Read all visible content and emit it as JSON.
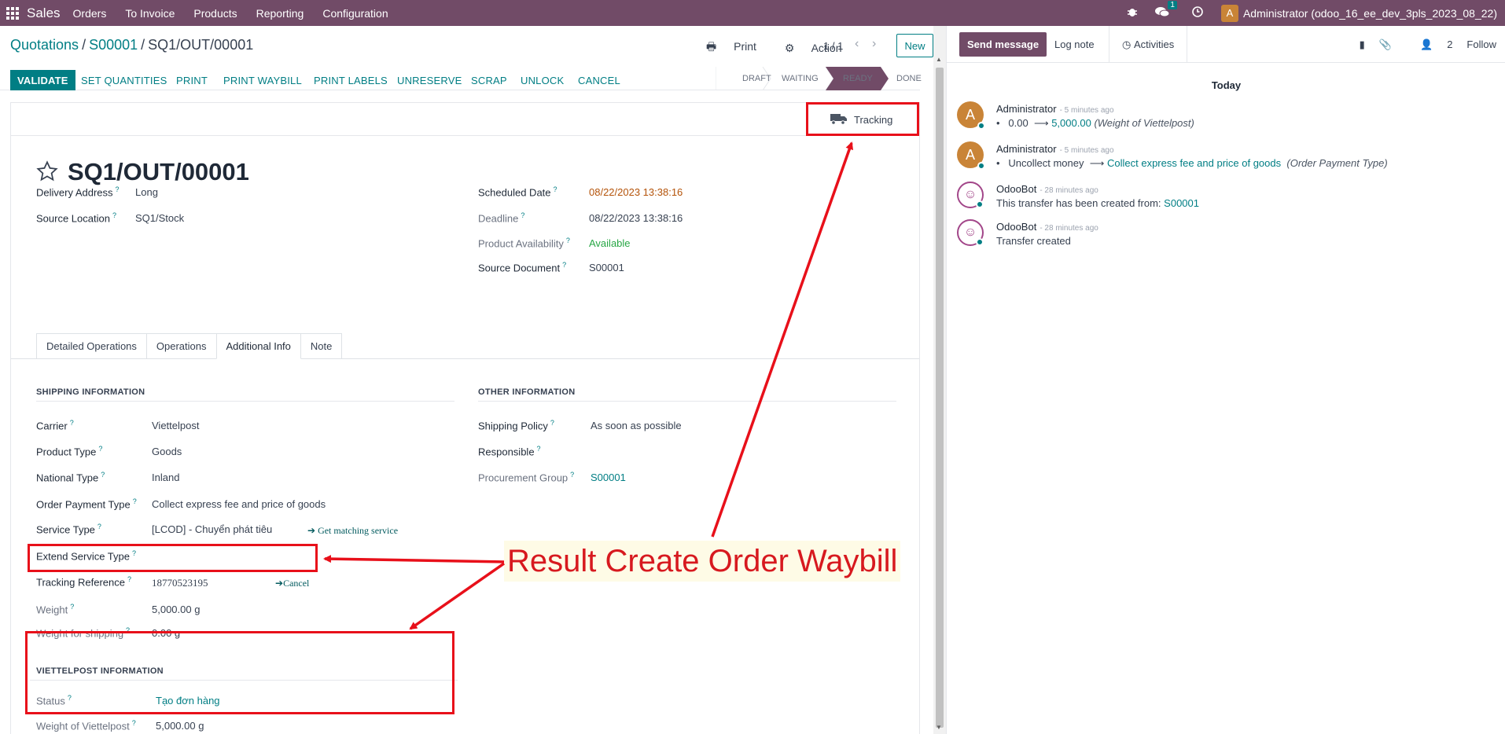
{
  "navbar": {
    "app_name": "Sales",
    "menu": [
      "Orders",
      "To Invoice",
      "Products",
      "Reporting",
      "Configuration"
    ],
    "chat_badge": "1",
    "user_initial": "A",
    "user_name": "Administrator (odoo_16_ee_dev_3pls_2023_08_22)"
  },
  "breadcrumb": {
    "root": "Quotations",
    "mid": "S00001",
    "current": "SQ1/OUT/00001"
  },
  "actions": {
    "print": "Print",
    "action": "Action"
  },
  "pager": "1 / 1",
  "new_button": "New",
  "statusbar": {
    "buttons": [
      "VALIDATE",
      "SET QUANTITIES",
      "PRINT",
      "PRINT WAYBILL",
      "PRINT LABELS",
      "UNRESERVE",
      "SCRAP",
      "UNLOCK",
      "CANCEL"
    ],
    "stages": [
      "DRAFT",
      "WAITING",
      "READY",
      "DONE"
    ],
    "active_stage": "READY"
  },
  "tracking_button": "Tracking",
  "record": {
    "title": "SQ1/OUT/00001",
    "delivery_address_label": "Delivery Address",
    "delivery_address": "Long",
    "source_location_label": "Source Location",
    "source_location": "SQ1/Stock",
    "scheduled_date_label": "Scheduled Date",
    "scheduled_date": "08/22/2023 13:38:16",
    "deadline_label": "Deadline",
    "deadline": "08/22/2023 13:38:16",
    "availability_label": "Product Availability",
    "availability": "Available",
    "source_document_label": "Source Document",
    "source_document": "S00001"
  },
  "tabs": [
    "Detailed Operations",
    "Operations",
    "Additional Info",
    "Note"
  ],
  "shipping": {
    "header": "SHIPPING INFORMATION",
    "carrier_label": "Carrier",
    "carrier": "Viettelpost",
    "product_type_label": "Product Type",
    "product_type": "Goods",
    "national_type_label": "National Type",
    "national_type": "Inland",
    "order_payment_type_label": "Order Payment Type",
    "order_payment_type": "Collect express fee and price of goods",
    "service_type_label": "Service Type",
    "service_type": "[LCOD] - Chuyển phát tiêu",
    "get_matching_service": "Get matching service",
    "extend_service_type_label": "Extend Service Type",
    "tracking_ref_label": "Tracking Reference",
    "tracking_ref": "18770523195",
    "cancel_link": "Cancel",
    "weight_label": "Weight",
    "weight": "5,000.00 g",
    "weight_shipping_label": "Weight for shipping",
    "weight_shipping": "0.00 g"
  },
  "other": {
    "header": "OTHER INFORMATION",
    "shipping_policy_label": "Shipping Policy",
    "shipping_policy": "As soon as possible",
    "responsible_label": "Responsible",
    "procurement_group_label": "Procurement Group",
    "procurement_group": "S00001"
  },
  "viettelpost": {
    "header": "VIETTELPOST INFORMATION",
    "status_label": "Status",
    "status": "Tạo đơn hàng",
    "weight_label": "Weight of Viettelpost",
    "weight": "5,000.00 g"
  },
  "annotation": "Result Create Order Waybill",
  "chatter": {
    "send_message": "Send message",
    "log_note": "Log note",
    "activities": "Activities",
    "followers_count": "2",
    "follow": "Follow",
    "today": "Today",
    "messages": [
      {
        "author": "Administrator",
        "time": "- 5 minutes ago",
        "old": "0.00",
        "new": "5,000.00",
        "field": "(Weight of Viettelpost)",
        "initial": "A"
      },
      {
        "author": "Administrator",
        "time": "- 5 minutes ago",
        "old": "Uncollect money",
        "new": "Collect express fee and price of goods",
        "field": "(Order Payment Type)",
        "initial": "A"
      },
      {
        "author": "OdooBot",
        "time": "- 28 minutes ago",
        "text": "This transfer has been created from:",
        "link": "S00001"
      },
      {
        "author": "OdooBot",
        "time": "- 28 minutes ago",
        "text": "Transfer created"
      }
    ]
  },
  "colors": {
    "brand": "#714B67",
    "accent": "#017e84",
    "annotation_red": "#e8101a"
  }
}
